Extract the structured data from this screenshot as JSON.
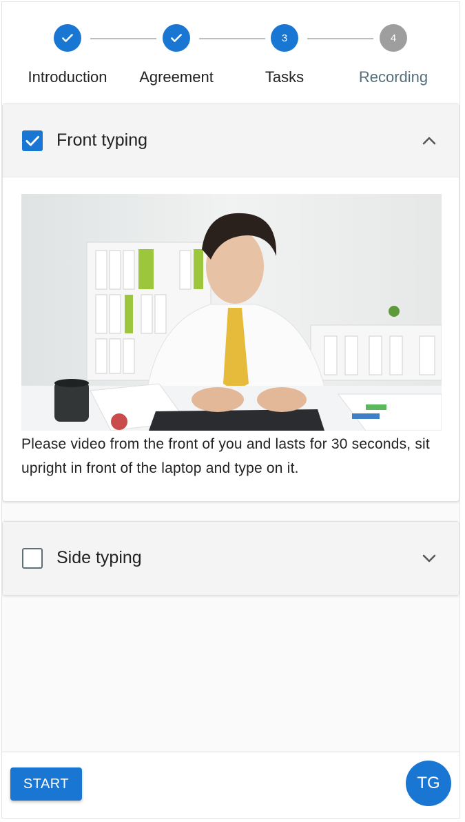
{
  "stepper": {
    "steps": [
      {
        "label": "Introduction",
        "status": "completed",
        "number": ""
      },
      {
        "label": "Agreement",
        "status": "completed",
        "number": ""
      },
      {
        "label": "Tasks",
        "status": "active",
        "number": "3"
      },
      {
        "label": "Recording",
        "status": "pending",
        "number": "4"
      }
    ]
  },
  "tasks": [
    {
      "title": "Front typing",
      "checked": true,
      "expanded": true,
      "description": "Please video from the front of you and lasts for 30 seconds, sit upright in front of the laptop and type on it."
    },
    {
      "title": "Side typing",
      "checked": false,
      "expanded": false
    }
  ],
  "footer": {
    "start_label": "START",
    "avatar_initials": "TG"
  },
  "colors": {
    "primary": "#1976d2",
    "pending_step": "#9e9e9e"
  }
}
